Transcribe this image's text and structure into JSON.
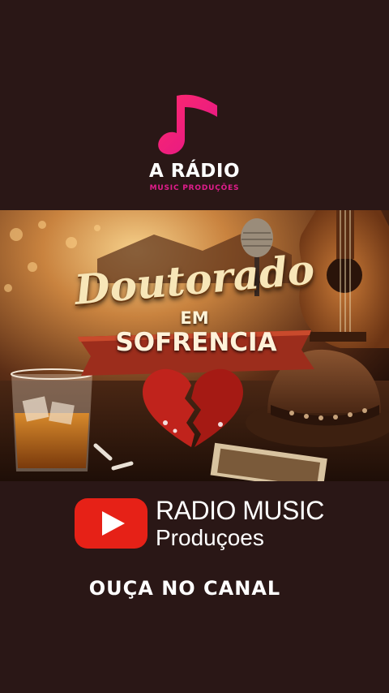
{
  "brand": {
    "title": "A RÁDIO",
    "subtitle": "MUSIC PRODUÇÕES",
    "icon": "music-note-icon",
    "accent": "#e11d8c"
  },
  "cover": {
    "title": "Doutorado",
    "connector": "EM",
    "subtitle": "SOFRENCIA"
  },
  "channel": {
    "icon": "youtube-icon",
    "name": "RADIO MUSIC",
    "subname": "Produçoes",
    "color": "#e62117"
  },
  "cta": "OUÇA NO CANAL"
}
